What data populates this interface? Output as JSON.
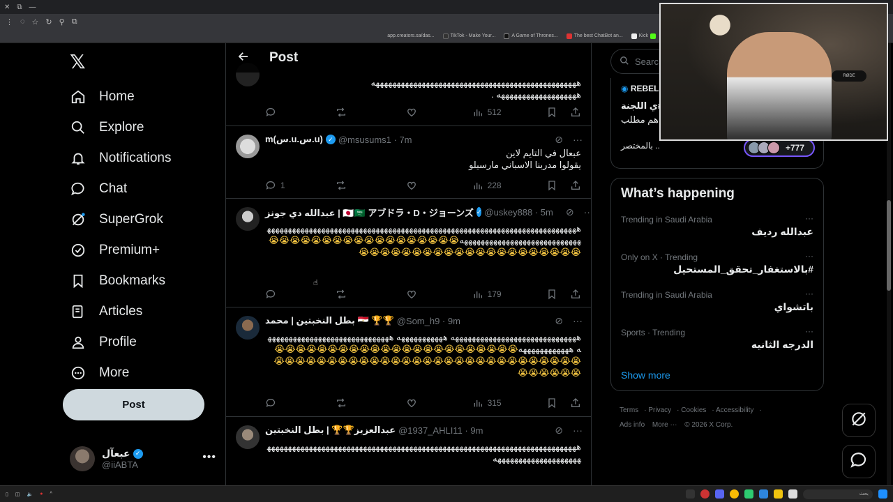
{
  "browser": {
    "bookmarks": [
      "app.creators.sa/das...",
      "TikTok - Make Your...",
      "A Game of Thrones...",
      "The best ChatBot an...",
      "Kick"
    ]
  },
  "nav": {
    "items": [
      {
        "label": "Home",
        "icon": "home-icon"
      },
      {
        "label": "Explore",
        "icon": "search-icon"
      },
      {
        "label": "Notifications",
        "icon": "bell-icon"
      },
      {
        "label": "Chat",
        "icon": "chat-icon"
      },
      {
        "label": "SuperGrok",
        "icon": "grok-icon"
      },
      {
        "label": "Premium+",
        "icon": "premium-icon"
      },
      {
        "label": "Bookmarks",
        "icon": "bookmark-icon"
      },
      {
        "label": "Articles",
        "icon": "articles-icon"
      },
      {
        "label": "Profile",
        "icon": "profile-icon"
      },
      {
        "label": "More",
        "icon": "more-icon"
      }
    ],
    "post_label": "Post",
    "account": {
      "name": "عبعآل",
      "handle": "@iiABTA"
    }
  },
  "main": {
    "title": "Post",
    "tweets": [
      {
        "body": "هههههههههههههههههههههههههههههههههههههههههههههههههه\nهههههههههههههههههههه .",
        "stats": {
          "reply": "",
          "retweet": "",
          "like": "",
          "views": "512"
        }
      },
      {
        "name": "m(س.u.س.u)",
        "handle": "@msusums1 · 7m",
        "body": "عبعال في التايم لاين\nيقولوا مدربنا الاسباني مارسيلو",
        "stats": {
          "reply": "1",
          "retweet": "",
          "like": "",
          "views": "228"
        }
      },
      {
        "name": "عبدالله دي جونز | 🇯🇵🇸🇦 アブドラ・D・ジョーンズ",
        "handle": "@uskey888 · 5m",
        "body": "هههههههههههههههههههههههههههههههههههههههههههههههههههههههههههههههههههههههههههههههههههههههههههههههههههههههه",
        "emojis": "😭😭😭😭😭😭😭😭😭😭😭😭😭😭😭😭😭😭😭😭😭😭😭😭😭😭😭😭😭😭😭😭😭😭😭😭😭😭😭",
        "stats": {
          "reply": "",
          "retweet": "",
          "like": "",
          "views": "179"
        }
      },
      {
        "name": "بطل النخبتين | محمد 🇪🇬 🏆🏆",
        "handle": "@Som_h9 · 9m",
        "body": "ههههههههههههههههههههههههههههههه هههههههههههه ههههههههههههههههههههههههههههههه ههههههههههههه",
        "emojis": "😭😭😭😭😭😭😭😭😭😭😭😭😭😭😭😭😭😭😭😭😭😭😭😭😭😭😭😭😭😭😭😭😭😭😭😭😭😭😭😭😭😭😭😭😭😭😭😭😭😭😭😭😭😭😭😭😭😭",
        "stats": {
          "reply": "",
          "retweet": "",
          "like": "",
          "views": "315"
        }
      },
      {
        "name": "عبدالعزيز🏆🏆 | بطل النخبتين",
        "handle": "@1937_AHLI11 · 9m",
        "body": "هههههههههههههههههههههههههههههههههههههههههههههههههههههههههههههههههههههههههههههههههههههههههههههههه",
        "stats": {
          "reply": "",
          "retweet": "",
          "like": "",
          "views": ""
        }
      }
    ]
  },
  "right": {
    "search_placeholder": "Search",
    "card": {
      "title": "REBEL",
      "line1": "ي اللجنة#",
      "line2": "هم مطلب",
      "line3": "بالمختصر ..",
      "count": "+777"
    },
    "happening": {
      "title": "What’s happening",
      "trends": [
        {
          "meta": "Trending in Saudi Arabia",
          "topic": "عبدالله رديف"
        },
        {
          "meta": "Only on X · Trending",
          "topic": "#بالاستغفار_تحقق_المستحيل"
        },
        {
          "meta": "Trending in Saudi Arabia",
          "topic": "باتشواي"
        },
        {
          "meta": "Sports · Trending",
          "topic": "الدرجه الثانيه"
        }
      ],
      "show_more": "Show more"
    },
    "footer": [
      "Terms",
      "Privacy",
      "Cookies",
      "Accessibility",
      "Ads info",
      "More ···",
      "© 2026 X Corp."
    ]
  },
  "webcam": {
    "mic_label": "RØDE"
  },
  "taskbar": {
    "search": "بحث"
  },
  "colors": {
    "accent": "#1d9bf0",
    "bg": "#000000",
    "border": "#2f3336",
    "muted": "#71767b"
  }
}
